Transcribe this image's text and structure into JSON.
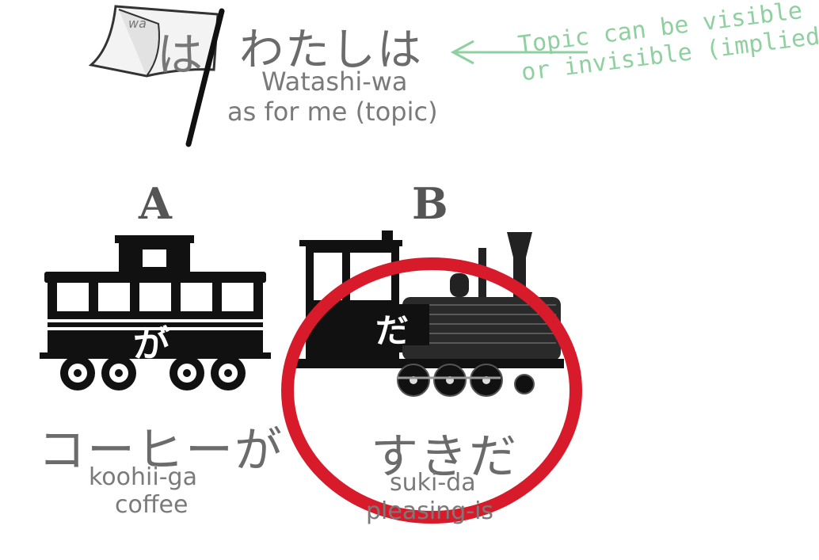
{
  "topic": {
    "flag_small": "wa",
    "flag_char": "は",
    "japanese": "わたしは",
    "romaji": "Watashi-wa",
    "gloss": "as for me (topic)"
  },
  "note": {
    "line1": "Topic can be visible",
    "line2": "or invisible (implied)",
    "color": "#8fd0a0"
  },
  "car_a": {
    "letter": "A",
    "kana": "が",
    "japanese": "コーヒーが",
    "romaji": "koohii-ga",
    "gloss": "coffee"
  },
  "car_b": {
    "letter": "B",
    "kana": "だ",
    "japanese": "すきだ",
    "romaji": "suki-da",
    "gloss": "pleasing-is"
  },
  "colors": {
    "highlight_circle": "#d81b2a",
    "text_grey": "#7a7a7a"
  }
}
